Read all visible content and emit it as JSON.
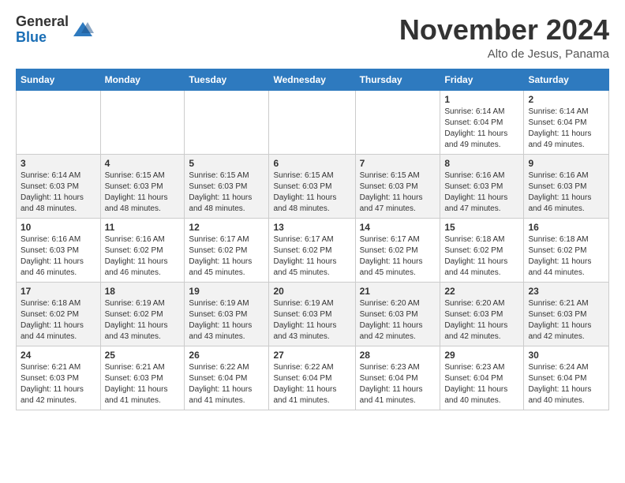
{
  "logo": {
    "general": "General",
    "blue": "Blue"
  },
  "header": {
    "month": "November 2024",
    "location": "Alto de Jesus, Panama"
  },
  "days_of_week": [
    "Sunday",
    "Monday",
    "Tuesday",
    "Wednesday",
    "Thursday",
    "Friday",
    "Saturday"
  ],
  "weeks": [
    [
      {
        "day": "",
        "info": ""
      },
      {
        "day": "",
        "info": ""
      },
      {
        "day": "",
        "info": ""
      },
      {
        "day": "",
        "info": ""
      },
      {
        "day": "",
        "info": ""
      },
      {
        "day": "1",
        "info": "Sunrise: 6:14 AM\nSunset: 6:04 PM\nDaylight: 11 hours\nand 49 minutes."
      },
      {
        "day": "2",
        "info": "Sunrise: 6:14 AM\nSunset: 6:04 PM\nDaylight: 11 hours\nand 49 minutes."
      }
    ],
    [
      {
        "day": "3",
        "info": "Sunrise: 6:14 AM\nSunset: 6:03 PM\nDaylight: 11 hours\nand 48 minutes."
      },
      {
        "day": "4",
        "info": "Sunrise: 6:15 AM\nSunset: 6:03 PM\nDaylight: 11 hours\nand 48 minutes."
      },
      {
        "day": "5",
        "info": "Sunrise: 6:15 AM\nSunset: 6:03 PM\nDaylight: 11 hours\nand 48 minutes."
      },
      {
        "day": "6",
        "info": "Sunrise: 6:15 AM\nSunset: 6:03 PM\nDaylight: 11 hours\nand 48 minutes."
      },
      {
        "day": "7",
        "info": "Sunrise: 6:15 AM\nSunset: 6:03 PM\nDaylight: 11 hours\nand 47 minutes."
      },
      {
        "day": "8",
        "info": "Sunrise: 6:16 AM\nSunset: 6:03 PM\nDaylight: 11 hours\nand 47 minutes."
      },
      {
        "day": "9",
        "info": "Sunrise: 6:16 AM\nSunset: 6:03 PM\nDaylight: 11 hours\nand 46 minutes."
      }
    ],
    [
      {
        "day": "10",
        "info": "Sunrise: 6:16 AM\nSunset: 6:03 PM\nDaylight: 11 hours\nand 46 minutes."
      },
      {
        "day": "11",
        "info": "Sunrise: 6:16 AM\nSunset: 6:02 PM\nDaylight: 11 hours\nand 46 minutes."
      },
      {
        "day": "12",
        "info": "Sunrise: 6:17 AM\nSunset: 6:02 PM\nDaylight: 11 hours\nand 45 minutes."
      },
      {
        "day": "13",
        "info": "Sunrise: 6:17 AM\nSunset: 6:02 PM\nDaylight: 11 hours\nand 45 minutes."
      },
      {
        "day": "14",
        "info": "Sunrise: 6:17 AM\nSunset: 6:02 PM\nDaylight: 11 hours\nand 45 minutes."
      },
      {
        "day": "15",
        "info": "Sunrise: 6:18 AM\nSunset: 6:02 PM\nDaylight: 11 hours\nand 44 minutes."
      },
      {
        "day": "16",
        "info": "Sunrise: 6:18 AM\nSunset: 6:02 PM\nDaylight: 11 hours\nand 44 minutes."
      }
    ],
    [
      {
        "day": "17",
        "info": "Sunrise: 6:18 AM\nSunset: 6:02 PM\nDaylight: 11 hours\nand 44 minutes."
      },
      {
        "day": "18",
        "info": "Sunrise: 6:19 AM\nSunset: 6:02 PM\nDaylight: 11 hours\nand 43 minutes."
      },
      {
        "day": "19",
        "info": "Sunrise: 6:19 AM\nSunset: 6:03 PM\nDaylight: 11 hours\nand 43 minutes."
      },
      {
        "day": "20",
        "info": "Sunrise: 6:19 AM\nSunset: 6:03 PM\nDaylight: 11 hours\nand 43 minutes."
      },
      {
        "day": "21",
        "info": "Sunrise: 6:20 AM\nSunset: 6:03 PM\nDaylight: 11 hours\nand 42 minutes."
      },
      {
        "day": "22",
        "info": "Sunrise: 6:20 AM\nSunset: 6:03 PM\nDaylight: 11 hours\nand 42 minutes."
      },
      {
        "day": "23",
        "info": "Sunrise: 6:21 AM\nSunset: 6:03 PM\nDaylight: 11 hours\nand 42 minutes."
      }
    ],
    [
      {
        "day": "24",
        "info": "Sunrise: 6:21 AM\nSunset: 6:03 PM\nDaylight: 11 hours\nand 42 minutes."
      },
      {
        "day": "25",
        "info": "Sunrise: 6:21 AM\nSunset: 6:03 PM\nDaylight: 11 hours\nand 41 minutes."
      },
      {
        "day": "26",
        "info": "Sunrise: 6:22 AM\nSunset: 6:04 PM\nDaylight: 11 hours\nand 41 minutes."
      },
      {
        "day": "27",
        "info": "Sunrise: 6:22 AM\nSunset: 6:04 PM\nDaylight: 11 hours\nand 41 minutes."
      },
      {
        "day": "28",
        "info": "Sunrise: 6:23 AM\nSunset: 6:04 PM\nDaylight: 11 hours\nand 41 minutes."
      },
      {
        "day": "29",
        "info": "Sunrise: 6:23 AM\nSunset: 6:04 PM\nDaylight: 11 hours\nand 40 minutes."
      },
      {
        "day": "30",
        "info": "Sunrise: 6:24 AM\nSunset: 6:04 PM\nDaylight: 11 hours\nand 40 minutes."
      }
    ]
  ]
}
